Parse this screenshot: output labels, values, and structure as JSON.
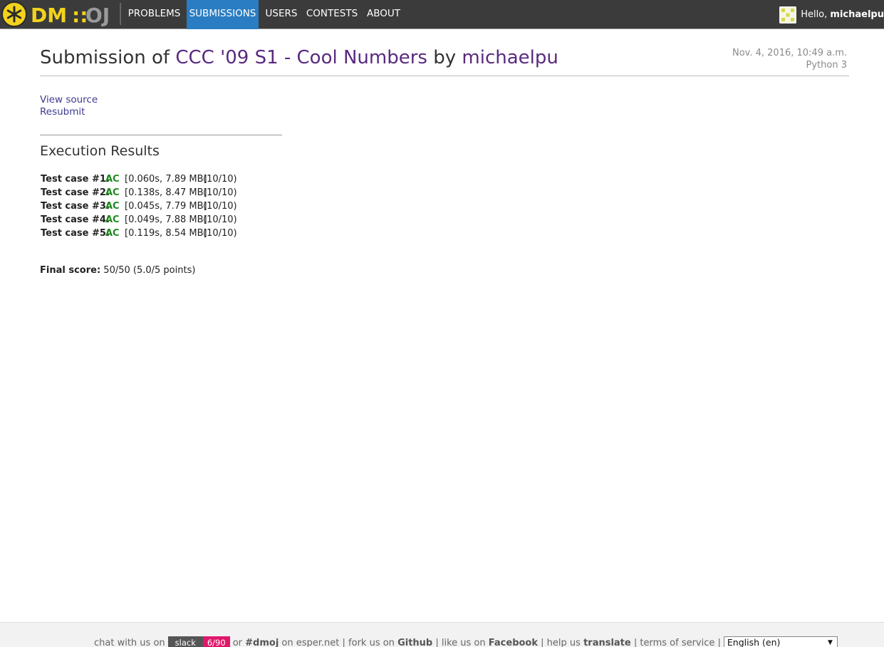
{
  "nav": {
    "logo_text": "DM::OJ",
    "items": [
      "PROBLEMS",
      "SUBMISSIONS",
      "USERS",
      "CONTESTS",
      "ABOUT"
    ],
    "active_index": 1,
    "greeting": "Hello,",
    "username": "michaelpu"
  },
  "header": {
    "title_prefix": "Submission of",
    "problem": "CCC '09 S1 - Cool Numbers",
    "by": "by",
    "user": "michaelpu",
    "date": "Nov. 4, 2016, 10:49 a.m.",
    "language": "Python 3"
  },
  "actions": {
    "view_source": "View source",
    "resubmit": "Resubmit"
  },
  "results": {
    "title": "Execution Results",
    "cases": [
      {
        "label": "Test case #1:",
        "status": "AC",
        "resources": "[0.060s, 7.89 MB]",
        "points": "(10/10)"
      },
      {
        "label": "Test case #2:",
        "status": "AC",
        "resources": "[0.138s, 8.47 MB]",
        "points": "(10/10)"
      },
      {
        "label": "Test case #3:",
        "status": "AC",
        "resources": "[0.045s, 7.79 MB]",
        "points": "(10/10)"
      },
      {
        "label": "Test case #4:",
        "status": "AC",
        "resources": "[0.049s, 7.88 MB]",
        "points": "(10/10)"
      },
      {
        "label": "Test case #5:",
        "status": "AC",
        "resources": "[0.119s, 8.54 MB]",
        "points": "(10/10)"
      }
    ],
    "final_label": "Final score:",
    "final_value": "50/50 (5.0/5 points)"
  },
  "footer": {
    "chat": "chat with us on",
    "slack": "slack",
    "slack_count": "6/90",
    "or": "or",
    "channel": "#dmoj",
    "on_esper": "on esper.net |",
    "fork": "fork us on",
    "github": "Github",
    "like": "| like us on",
    "facebook": "Facebook",
    "help": "| help us",
    "translate": "translate",
    "tos": "| terms of service |",
    "language": "English (en)"
  },
  "colors": {
    "nav_bg": "#3b3b3b",
    "nav_active": "#2a7dc2",
    "logo_yellow": "#f2d21c",
    "link_purple": "#5a2a7f",
    "ac_green": "#1e8a1e",
    "slack_pink": "#e0186c"
  }
}
